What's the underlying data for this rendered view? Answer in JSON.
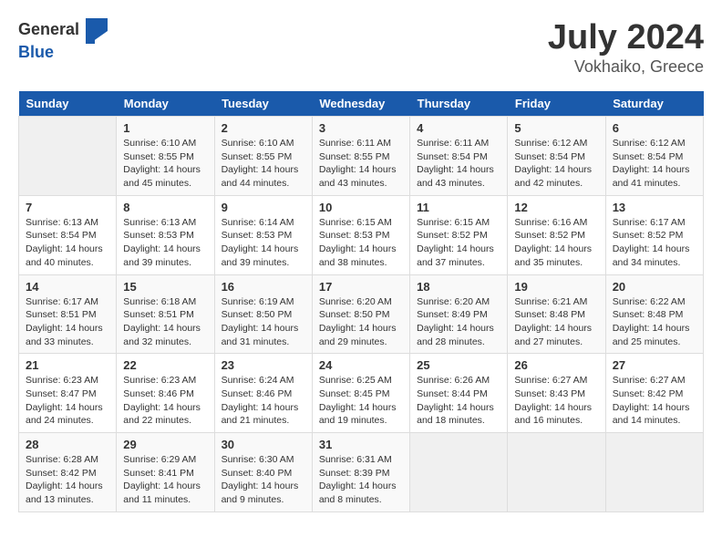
{
  "logo": {
    "general": "General",
    "blue": "Blue"
  },
  "title": "July 2024",
  "subtitle": "Vokhaiko, Greece",
  "weekdays": [
    "Sunday",
    "Monday",
    "Tuesday",
    "Wednesday",
    "Thursday",
    "Friday",
    "Saturday"
  ],
  "weeks": [
    [
      null,
      {
        "day": 1,
        "sunrise": "6:10 AM",
        "sunset": "8:55 PM",
        "daylight": "14 hours and 45 minutes."
      },
      {
        "day": 2,
        "sunrise": "6:10 AM",
        "sunset": "8:55 PM",
        "daylight": "14 hours and 44 minutes."
      },
      {
        "day": 3,
        "sunrise": "6:11 AM",
        "sunset": "8:55 PM",
        "daylight": "14 hours and 43 minutes."
      },
      {
        "day": 4,
        "sunrise": "6:11 AM",
        "sunset": "8:54 PM",
        "daylight": "14 hours and 43 minutes."
      },
      {
        "day": 5,
        "sunrise": "6:12 AM",
        "sunset": "8:54 PM",
        "daylight": "14 hours and 42 minutes."
      },
      {
        "day": 6,
        "sunrise": "6:12 AM",
        "sunset": "8:54 PM",
        "daylight": "14 hours and 41 minutes."
      }
    ],
    [
      {
        "day": 7,
        "sunrise": "6:13 AM",
        "sunset": "8:54 PM",
        "daylight": "14 hours and 40 minutes."
      },
      {
        "day": 8,
        "sunrise": "6:13 AM",
        "sunset": "8:53 PM",
        "daylight": "14 hours and 39 minutes."
      },
      {
        "day": 9,
        "sunrise": "6:14 AM",
        "sunset": "8:53 PM",
        "daylight": "14 hours and 39 minutes."
      },
      {
        "day": 10,
        "sunrise": "6:15 AM",
        "sunset": "8:53 PM",
        "daylight": "14 hours and 38 minutes."
      },
      {
        "day": 11,
        "sunrise": "6:15 AM",
        "sunset": "8:52 PM",
        "daylight": "14 hours and 37 minutes."
      },
      {
        "day": 12,
        "sunrise": "6:16 AM",
        "sunset": "8:52 PM",
        "daylight": "14 hours and 35 minutes."
      },
      {
        "day": 13,
        "sunrise": "6:17 AM",
        "sunset": "8:52 PM",
        "daylight": "14 hours and 34 minutes."
      }
    ],
    [
      {
        "day": 14,
        "sunrise": "6:17 AM",
        "sunset": "8:51 PM",
        "daylight": "14 hours and 33 minutes."
      },
      {
        "day": 15,
        "sunrise": "6:18 AM",
        "sunset": "8:51 PM",
        "daylight": "14 hours and 32 minutes."
      },
      {
        "day": 16,
        "sunrise": "6:19 AM",
        "sunset": "8:50 PM",
        "daylight": "14 hours and 31 minutes."
      },
      {
        "day": 17,
        "sunrise": "6:20 AM",
        "sunset": "8:50 PM",
        "daylight": "14 hours and 29 minutes."
      },
      {
        "day": 18,
        "sunrise": "6:20 AM",
        "sunset": "8:49 PM",
        "daylight": "14 hours and 28 minutes."
      },
      {
        "day": 19,
        "sunrise": "6:21 AM",
        "sunset": "8:48 PM",
        "daylight": "14 hours and 27 minutes."
      },
      {
        "day": 20,
        "sunrise": "6:22 AM",
        "sunset": "8:48 PM",
        "daylight": "14 hours and 25 minutes."
      }
    ],
    [
      {
        "day": 21,
        "sunrise": "6:23 AM",
        "sunset": "8:47 PM",
        "daylight": "14 hours and 24 minutes."
      },
      {
        "day": 22,
        "sunrise": "6:23 AM",
        "sunset": "8:46 PM",
        "daylight": "14 hours and 22 minutes."
      },
      {
        "day": 23,
        "sunrise": "6:24 AM",
        "sunset": "8:46 PM",
        "daylight": "14 hours and 21 minutes."
      },
      {
        "day": 24,
        "sunrise": "6:25 AM",
        "sunset": "8:45 PM",
        "daylight": "14 hours and 19 minutes."
      },
      {
        "day": 25,
        "sunrise": "6:26 AM",
        "sunset": "8:44 PM",
        "daylight": "14 hours and 18 minutes."
      },
      {
        "day": 26,
        "sunrise": "6:27 AM",
        "sunset": "8:43 PM",
        "daylight": "14 hours and 16 minutes."
      },
      {
        "day": 27,
        "sunrise": "6:27 AM",
        "sunset": "8:42 PM",
        "daylight": "14 hours and 14 minutes."
      }
    ],
    [
      {
        "day": 28,
        "sunrise": "6:28 AM",
        "sunset": "8:42 PM",
        "daylight": "14 hours and 13 minutes."
      },
      {
        "day": 29,
        "sunrise": "6:29 AM",
        "sunset": "8:41 PM",
        "daylight": "14 hours and 11 minutes."
      },
      {
        "day": 30,
        "sunrise": "6:30 AM",
        "sunset": "8:40 PM",
        "daylight": "14 hours and 9 minutes."
      },
      {
        "day": 31,
        "sunrise": "6:31 AM",
        "sunset": "8:39 PM",
        "daylight": "14 hours and 8 minutes."
      },
      null,
      null,
      null
    ]
  ]
}
